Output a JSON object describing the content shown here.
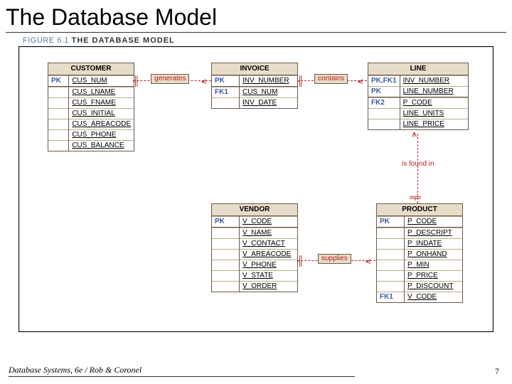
{
  "title": "The Database Model",
  "figure": {
    "num": "FIGURE 6.1",
    "caption": "THE DATABASE MODEL"
  },
  "entities": {
    "customer": {
      "name": "CUSTOMER",
      "rows": [
        {
          "key": "PK",
          "attr": "CUS_NUM"
        },
        {
          "sep": true
        },
        {
          "key": "",
          "attr": "CUS_LNAME"
        },
        {
          "key": "",
          "attr": "CUS_FNAME"
        },
        {
          "key": "",
          "attr": "CUS_INITIAL"
        },
        {
          "key": "",
          "attr": "CUS_AREACODE"
        },
        {
          "key": "",
          "attr": "CUS_PHONE"
        },
        {
          "key": "",
          "attr": "CUS_BALANCE"
        }
      ]
    },
    "invoice": {
      "name": "INVOICE",
      "rows": [
        {
          "key": "PK",
          "attr": "INV_NUMBER"
        },
        {
          "sep": true
        },
        {
          "key": "FK1",
          "attr": "CUS_NUM"
        },
        {
          "key": "",
          "attr": "INV_DATE"
        }
      ]
    },
    "line": {
      "name": "LINE",
      "rows": [
        {
          "key": "PK,FK1",
          "attr": "INV_NUMBER"
        },
        {
          "key": "PK",
          "attr": "LINE_NUMBER"
        },
        {
          "sep": true
        },
        {
          "key": "FK2",
          "attr": "P_CODE"
        },
        {
          "key": "",
          "attr": "LINE_UNITS"
        },
        {
          "key": "",
          "attr": "LINE_PRICE"
        }
      ]
    },
    "vendor": {
      "name": "VENDOR",
      "rows": [
        {
          "key": "PK",
          "attr": "V_CODE"
        },
        {
          "sep": true
        },
        {
          "key": "",
          "attr": "V_NAME"
        },
        {
          "key": "",
          "attr": "V_CONTACT"
        },
        {
          "key": "",
          "attr": "V_AREACODE"
        },
        {
          "key": "",
          "attr": "V_PHONE"
        },
        {
          "key": "",
          "attr": "V_STATE"
        },
        {
          "key": "",
          "attr": "V_ORDER"
        }
      ]
    },
    "product": {
      "name": "PRODUCT",
      "rows": [
        {
          "key": "PK",
          "attr": "P_CODE"
        },
        {
          "sep": true
        },
        {
          "key": "",
          "attr": "P_DESCRIPT"
        },
        {
          "key": "",
          "attr": "P_INDATE"
        },
        {
          "key": "",
          "attr": "P_ONHAND"
        },
        {
          "key": "",
          "attr": "P_MIN"
        },
        {
          "key": "",
          "attr": "P_PRICE"
        },
        {
          "key": "",
          "attr": "P_DISCOUNT"
        },
        {
          "key": "FK1",
          "attr": "V_CODE"
        }
      ]
    }
  },
  "relationships": {
    "generates": "generates",
    "contains": "contains",
    "is_found_in": "is found in",
    "supplies": "supplies"
  },
  "footer": "Database Systems, 6e / Rob & Coronel",
  "page": "7",
  "colors": {
    "accent": "#b22",
    "entity_header": "#e7dcc8"
  }
}
